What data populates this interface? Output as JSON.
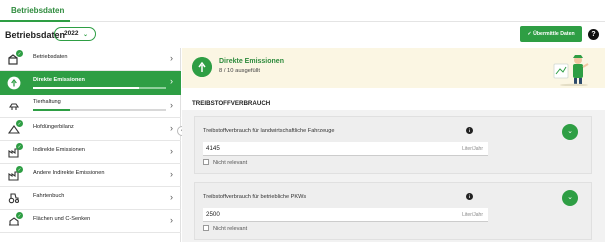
{
  "top_tab": {
    "label": "Betriebsdaten"
  },
  "header": {
    "title": "Betriebsdaten",
    "year": "2022",
    "submit_label": "Übermittle Daten",
    "help_label": "?"
  },
  "sidebar": {
    "items": [
      {
        "label": "Betriebsdaten",
        "checked": true,
        "active": false,
        "progress": null
      },
      {
        "label": "Direkte Emissionen",
        "checked": false,
        "active": true,
        "progress": 0.8
      },
      {
        "label": "Tierhaltung",
        "checked": false,
        "active": false,
        "progress": 0.28
      },
      {
        "label": "Hofdüngerbilanz",
        "checked": true,
        "active": false,
        "progress": null
      },
      {
        "label": "Indirekte Emissionen",
        "checked": true,
        "active": false,
        "progress": null
      },
      {
        "label": "Andere Indirekte Emissionen",
        "checked": true,
        "active": false,
        "progress": null
      },
      {
        "label": "Fahrtenbuch",
        "checked": false,
        "active": false,
        "progress": null
      },
      {
        "label": "Flächen und C-Senken",
        "checked": true,
        "active": false,
        "progress": null
      }
    ]
  },
  "banner": {
    "title": "Direkte Emissionen",
    "subtitle": "8 / 10 ausgefüllt"
  },
  "section": {
    "title": "TREIBSTOFFVERBRAUCH"
  },
  "cards": [
    {
      "question": "Treibstoffverbrauch für landwirtschaftliche Fahrzeuge",
      "value": "4145",
      "unit": "Liter/Jahr",
      "not_relevant": "Nicht relevant"
    },
    {
      "question": "Treibstoffverbrauch für betriebliche PKWs",
      "value": "2500",
      "unit": "Liter/Jahr",
      "not_relevant": "Nicht relevant"
    }
  ],
  "colors": {
    "accent": "#2e9e44",
    "banner_bg": "#fbf6e3"
  }
}
